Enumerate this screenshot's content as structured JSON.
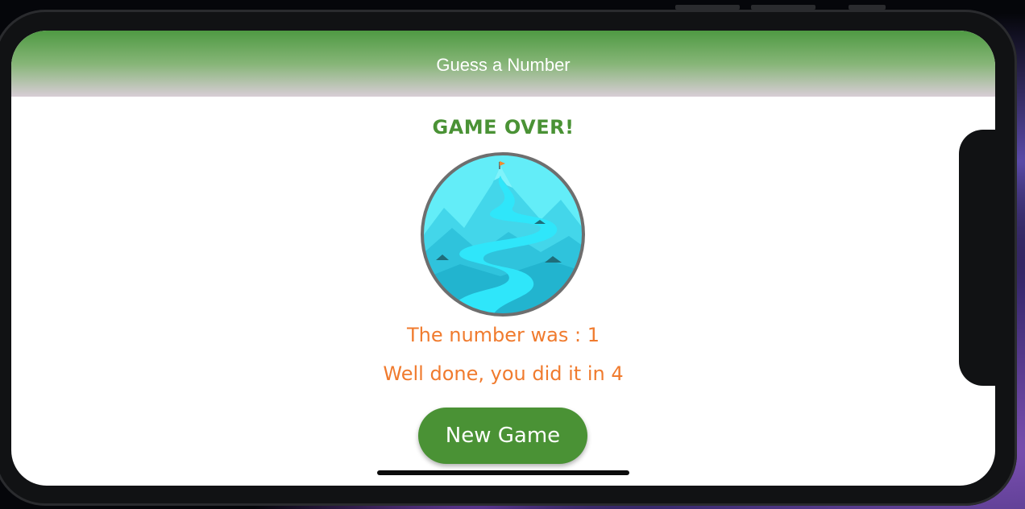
{
  "header": {
    "title": "Guess a Number"
  },
  "main": {
    "status": "GAME OVER!",
    "number_line": "The number was : 1",
    "result_line": "Well done, you did it in 4",
    "new_game_label": "New Game"
  },
  "colors": {
    "header_green": "#4f9a43",
    "accent_green": "#4a9235",
    "result_orange": "#f07b2e"
  },
  "icons": {
    "goal_image": "mountain-path-image"
  }
}
